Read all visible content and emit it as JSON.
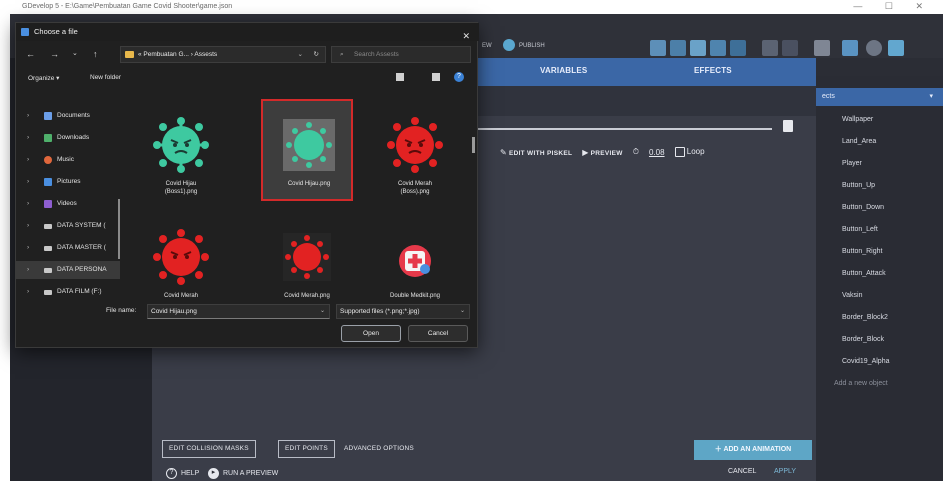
{
  "window": {
    "title": "GDevelop 5 - E:\\Game\\Pembuatan Game Covid Shooter\\game.json",
    "controls": "— ☐ ✕"
  },
  "toolbar": {
    "preview_label": "EW",
    "publish_label": "PUBLISH"
  },
  "object_editor": {
    "tabs": [
      "VARIABLES",
      "EFFECTS"
    ],
    "edit_with_piskel": "EDIT WITH PISKEL",
    "preview": "PREVIEW",
    "timing_value": "0.08",
    "loop_label": "Loop",
    "edit_collision_masks": "EDIT COLLISION MASKS",
    "edit_points": "EDIT POINTS",
    "advanced_options": "ADVANCED OPTIONS",
    "add_animation": "ADD AN ANIMATION",
    "help": "HELP",
    "run_preview": "RUN A PREVIEW",
    "cancel": "CANCEL",
    "apply": "APPLY"
  },
  "objects_panel": {
    "header": "ects",
    "items": [
      "Wallpaper",
      "Land_Area",
      "Player",
      "Button_Up",
      "Button_Down",
      "Button_Left",
      "Button_Right",
      "Button_Attack",
      "Vaksin",
      "Border_Block2",
      "Border_Block",
      "Covid19_Alpha"
    ],
    "add_new": "Add a new object"
  },
  "file_dialog": {
    "title": "Choose a file",
    "breadcrumb": "« Pembuatan G... › Assests",
    "search_placeholder": "Search Assests",
    "organize": "Organize ▾",
    "new_folder": "New folder",
    "sidebar": [
      {
        "label": "Documents",
        "color": "#6b9ee8"
      },
      {
        "label": "Downloads",
        "color": "#4fb06b"
      },
      {
        "label": "Music",
        "color": "#e0673c"
      },
      {
        "label": "Pictures",
        "color": "#4a8fe0"
      },
      {
        "label": "Videos",
        "color": "#8e5ed0"
      },
      {
        "label": "DATA SYSTEM (",
        "color": "#c8c8c8"
      },
      {
        "label": "DATA MASTER (",
        "color": "#c8c8c8"
      },
      {
        "label": "DATA PERSONA",
        "color": "#c8c8c8"
      },
      {
        "label": "DATA FILM (F:)",
        "color": "#c8c8c8"
      }
    ],
    "files": [
      {
        "name": "Covid Hijau\n(Boss1).png",
        "kind": "green-virus-angry"
      },
      {
        "name": "Covid Hijau.png",
        "kind": "green-virus"
      },
      {
        "name": "Covid Merah\n(Boss).png",
        "kind": "red-virus-angry"
      },
      {
        "name": "Covid Merah",
        "kind": "red-virus-angry"
      },
      {
        "name": "Covid Merah.png",
        "kind": "red-virus"
      },
      {
        "name": "Double Medkit.png",
        "kind": "medkit"
      }
    ],
    "filename_label": "File name:",
    "filename_value": "Covid Hijau.png",
    "filetype": "Supported files (*.png;*.jpg)",
    "open": "Open",
    "cancel": "Cancel"
  },
  "colors": {
    "accent_blue": "#3b67a6",
    "virus_green": "#3ec9a0",
    "virus_red": "#e22222",
    "selection_red": "#d32a2a"
  }
}
